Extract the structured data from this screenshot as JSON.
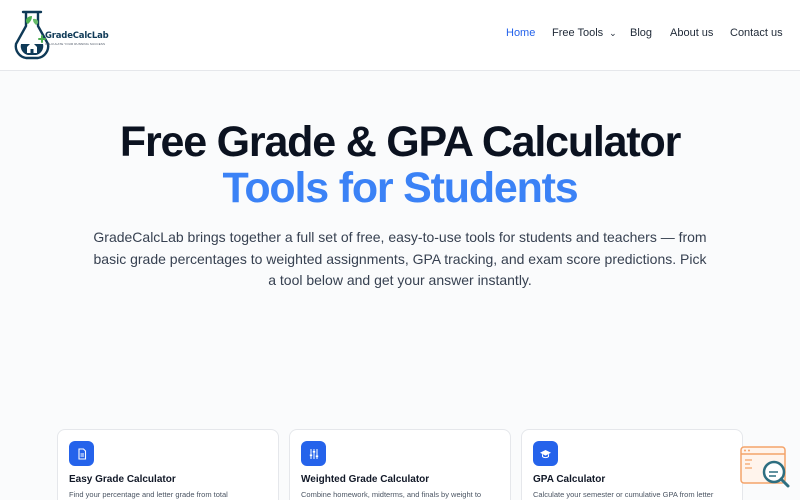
{
  "brand": {
    "name": "GradeCalcLab",
    "tagline": "CALCULATE YOUR RUNNING SUCCESS"
  },
  "nav": {
    "items": [
      {
        "label": "Home",
        "active": true
      },
      {
        "label": "Free Tools",
        "has_dropdown": true
      },
      {
        "label": "Blog"
      },
      {
        "label": "About us"
      },
      {
        "label": "Contact us"
      }
    ]
  },
  "hero": {
    "title_line1": "Free Grade & GPA Calculator",
    "title_line2": "Tools for Students",
    "description": "GradeCalcLab brings together a full set of free, easy-to-use tools for students and teachers — from basic grade percentages to weighted assignments, GPA tracking, and exam score predictions. Pick a tool below and get your answer instantly."
  },
  "cards": [
    {
      "title": "Easy Grade Calculator",
      "description": "Find your percentage and letter grade from total",
      "icon": "document-icon"
    },
    {
      "title": "Weighted Grade Calculator",
      "description": "Combine homework, midterms, and finals by weight to",
      "icon": "sliders-icon"
    },
    {
      "title": "GPA Calculator",
      "description": "Calculate your semester or cumulative GPA from letter",
      "icon": "graduation-cap-icon"
    }
  ],
  "colors": {
    "accent": "#3b82f6",
    "nav_active": "#2563eb",
    "heading": "#0b1220",
    "icon_bg": "#2563eb",
    "brand_green": "#4caf50",
    "brand_navy": "#0f3a57"
  }
}
